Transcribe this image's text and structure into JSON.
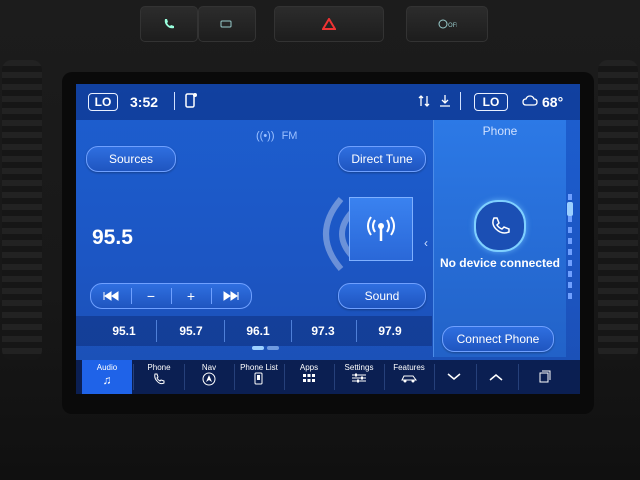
{
  "status": {
    "left_climate": "LO",
    "time": "3:52",
    "right_climate": "LO",
    "outside_temp": "68°"
  },
  "source": {
    "band": "FM",
    "sources_label": "Sources",
    "direct_tune_label": "Direct Tune",
    "sound_label": "Sound",
    "frequency": "95.5"
  },
  "presets": [
    "95.1",
    "95.7",
    "96.1",
    "97.3",
    "97.9"
  ],
  "phone_panel": {
    "title": "Phone",
    "status": "No device connected",
    "connect_label": "Connect Phone"
  },
  "nav": {
    "items": [
      {
        "label": "Audio",
        "icon": "music-note-icon"
      },
      {
        "label": "Phone",
        "icon": "phone-icon"
      },
      {
        "label": "Nav",
        "icon": "navigation-icon"
      },
      {
        "label": "Phone List",
        "icon": "phone-list-icon"
      },
      {
        "label": "Apps",
        "icon": "apps-grid-icon"
      },
      {
        "label": "Settings",
        "icon": "settings-sliders-icon"
      },
      {
        "label": "Features",
        "icon": "car-features-icon"
      }
    ],
    "active": "Audio"
  },
  "colors": {
    "screen_blue": "#1d5fd0",
    "active_tab": "#1f63e8",
    "navbar": "#0b1f52"
  }
}
